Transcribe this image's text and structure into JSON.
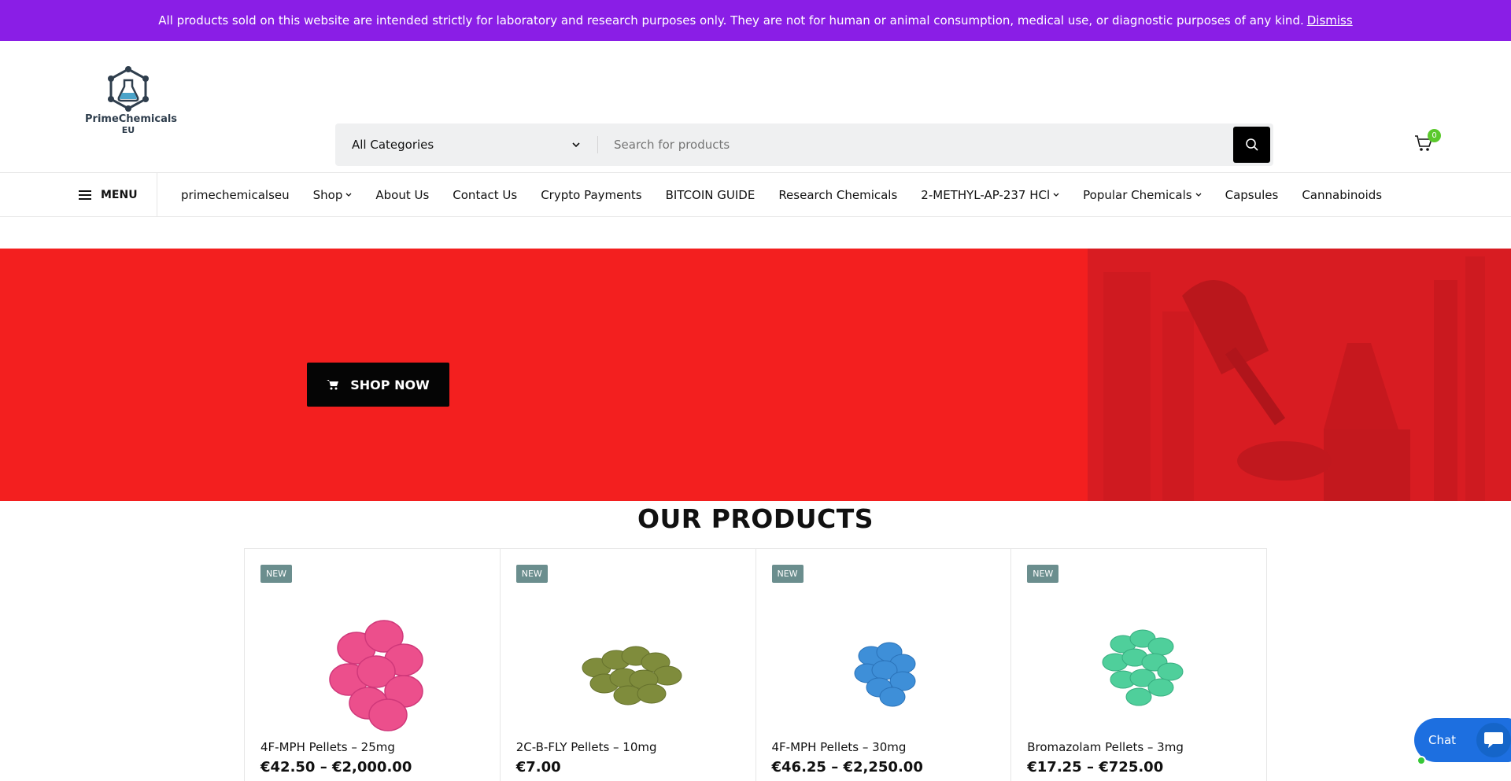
{
  "notice": {
    "text": "All products sold on this website are intended strictly for laboratory and research purposes only. They are not for human or animal consumption, medical use, or diagnostic purposes of any kind.",
    "dismiss": "Dismiss"
  },
  "logo": {
    "name": "PrimeChemicals",
    "sub": "EU"
  },
  "search": {
    "category": "All Categories",
    "placeholder": "Search for products"
  },
  "cart": {
    "count": "0"
  },
  "nav": {
    "menu_label": "MENU",
    "items": [
      {
        "label": "primechemicalseu"
      },
      {
        "label": "Shop"
      },
      {
        "label": "About Us"
      },
      {
        "label": "Contact Us"
      },
      {
        "label": "Crypto Payments"
      },
      {
        "label": "BITCOIN GUIDE"
      },
      {
        "label": "Research Chemicals"
      },
      {
        "label": "2-METHYL-AP-237 HCl"
      },
      {
        "label": "Popular Chemicals"
      },
      {
        "label": "Capsules"
      },
      {
        "label": "Cannabinoids"
      }
    ]
  },
  "hero": {
    "button": "SHOP NOW",
    "color": "#f31f1f"
  },
  "products_section": {
    "title": "OUR PRODUCTS"
  },
  "products": [
    {
      "tag": "NEW",
      "name": "4F-MPH Pellets – 25mg",
      "price": "€42.50 – €2,000.00",
      "pill_color": "#ec4f8c"
    },
    {
      "tag": "NEW",
      "name": "2C-B-FLY Pellets – 10mg",
      "price": "€7.00",
      "pill_color": "#7f8c3c"
    },
    {
      "tag": "NEW",
      "name": "4F-MPH Pellets – 30mg",
      "price": "€46.25 – €2,250.00",
      "pill_color": "#3e8fd8"
    },
    {
      "tag": "NEW",
      "name": "Bromazolam Pellets – 3mg",
      "price": "€17.25 – €725.00",
      "pill_color": "#4fcf9b"
    }
  ],
  "chat": {
    "label": "Chat"
  }
}
